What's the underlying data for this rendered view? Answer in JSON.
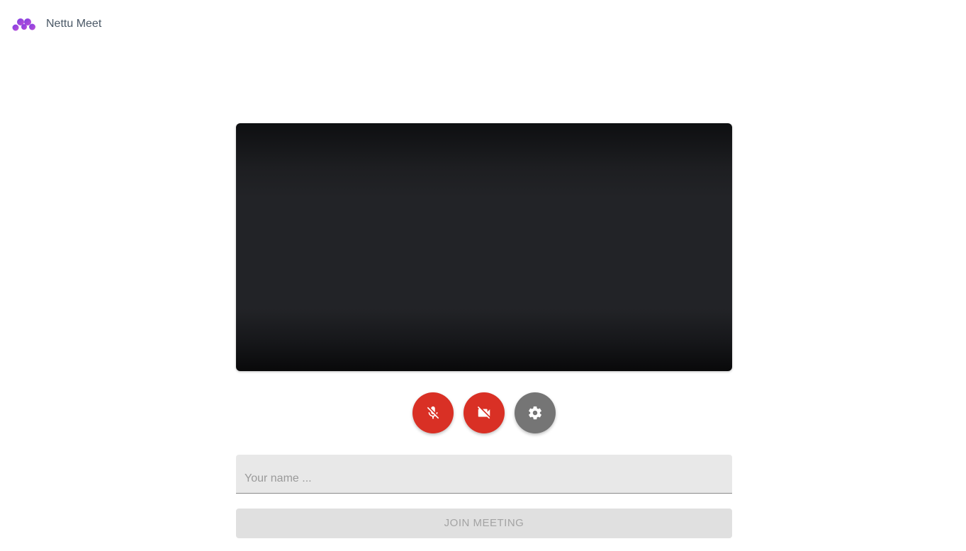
{
  "header": {
    "app_title": "Nettu Meet",
    "logo_icon": "nettu-logo-icon"
  },
  "preview": {
    "state": "camera-off"
  },
  "controls": {
    "mic": {
      "icon": "mic-off-icon",
      "state": "muted",
      "color": "#d93025"
    },
    "camera": {
      "icon": "videocam-off-icon",
      "state": "off",
      "color": "#d93025"
    },
    "settings": {
      "icon": "gear-icon",
      "color": "#757575"
    }
  },
  "form": {
    "name_placeholder": "Your name ...",
    "name_value": "",
    "join_label": "JOIN MEETING",
    "join_disabled": true
  }
}
